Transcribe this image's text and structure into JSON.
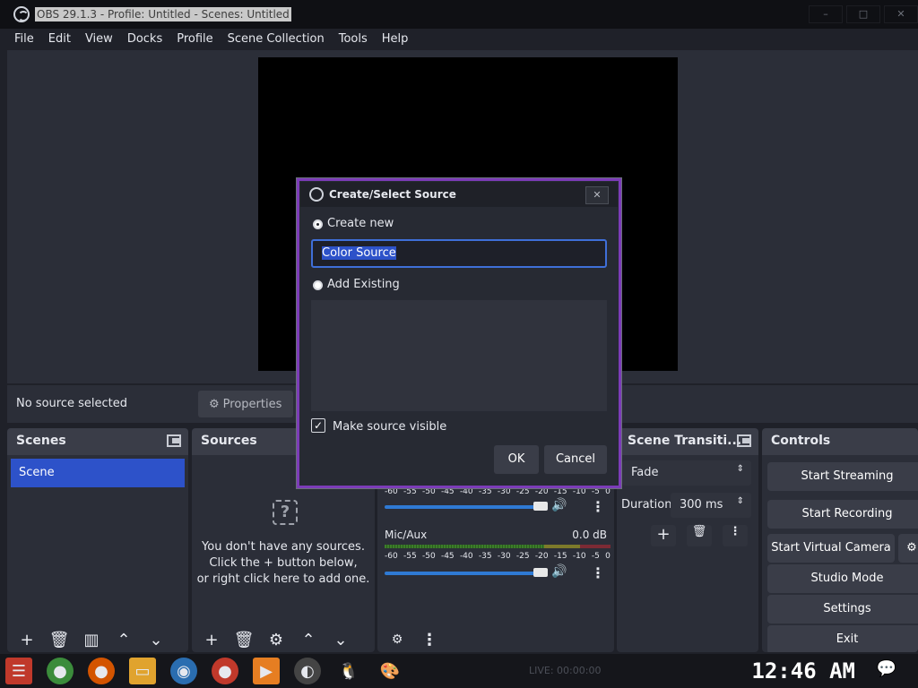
{
  "window": {
    "title": "OBS 29.1.3 - Profile: Untitled - Scenes: Untitled",
    "buttons": [
      "–",
      "□",
      "✕"
    ]
  },
  "menu": [
    "File",
    "Edit",
    "View",
    "Docks",
    "Profile",
    "Scene Collection",
    "Tools",
    "Help"
  ],
  "context_bar": {
    "no_source": "No source selected",
    "properties": "Properties"
  },
  "scenes": {
    "title": "Scenes",
    "items": [
      "Scene"
    ]
  },
  "sources": {
    "title": "Sources",
    "empty_line1": "You don't have any sources.",
    "empty_line2": "Click the + button below,",
    "empty_line3": "or right click here to add one."
  },
  "mixer": {
    "channels": [
      {
        "name": "",
        "db": ""
      },
      {
        "name": "Mic/Aux",
        "db": "0.0 dB"
      }
    ],
    "ticks": [
      "-60",
      "-55",
      "-50",
      "-45",
      "-40",
      "-35",
      "-30",
      "-25",
      "-20",
      "-15",
      "-10",
      "-5",
      "0"
    ]
  },
  "transitions": {
    "title": "Scene Transiti...",
    "selected": "Fade",
    "duration_label": "Duration",
    "duration_value": "300 ms"
  },
  "controls": {
    "title": "Controls",
    "buttons": [
      "Start Streaming",
      "Start Recording",
      "Start Virtual Camera",
      "Studio Mode",
      "Settings",
      "Exit"
    ]
  },
  "dialog": {
    "title": "Create/Select Source",
    "create_new": "Create new",
    "name_value": "Color Source",
    "add_existing": "Add Existing",
    "make_visible": "Make source visible",
    "ok": "OK",
    "cancel": "Cancel"
  },
  "taskbar": {
    "live": "LIVE: 00:00:00",
    "clock": "12:46 AM"
  }
}
